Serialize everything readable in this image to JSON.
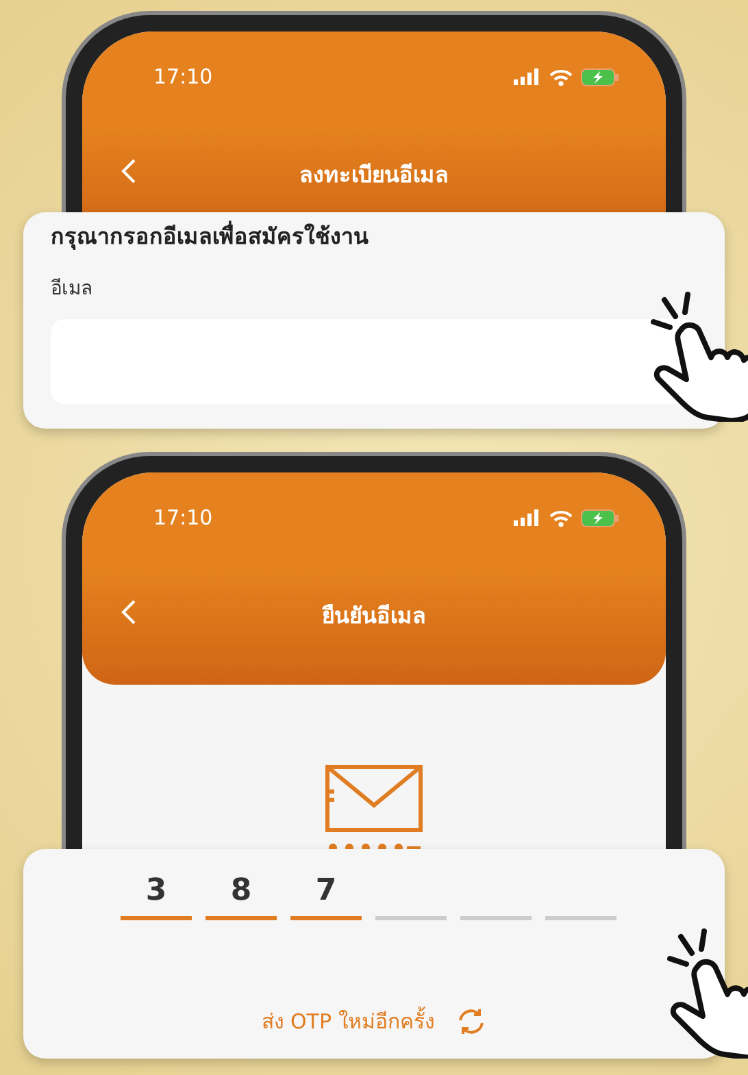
{
  "screens": [
    {
      "kind": "email",
      "status_time": "17:10",
      "title": "ลงทะเบียนอีเมล",
      "prompt": "กรุณากรอกอีเมลเพื่อสมัครใช้งาน",
      "field_label": "อีเมล"
    },
    {
      "kind": "otp",
      "status_time": "17:10",
      "title": "ยืนยันอีเมล",
      "otp_digits": [
        {
          "value": "3",
          "filled": true
        },
        {
          "value": "8",
          "filled": true
        },
        {
          "value": "7",
          "filled": true
        },
        {
          "filled": false
        },
        {
          "filled": false
        },
        {
          "filled": false
        }
      ],
      "resend_link": "ส่ง OTP ใหม่อีกครั้ง"
    }
  ]
}
